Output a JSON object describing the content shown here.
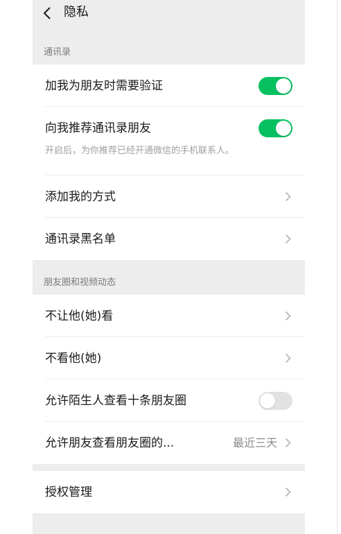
{
  "header": {
    "title": "隐私",
    "back_icon": "chevron-left-icon"
  },
  "sections": {
    "contacts": {
      "label": "通讯录"
    },
    "moments": {
      "label": "朋友圈和视频动态"
    }
  },
  "rows": {
    "verify": {
      "label": "加我为朋友时需要验证",
      "toggle": true
    },
    "recommend": {
      "label": "向我推荐通讯录朋友",
      "desc": "开启后，为你推荐已经开通微信的手机联系人。",
      "toggle": true
    },
    "add_methods": {
      "label": "添加我的方式"
    },
    "blacklist": {
      "label": "通讯录黑名单"
    },
    "hide_from": {
      "label": "不让他(她)看"
    },
    "dont_see": {
      "label": "不看他(她)"
    },
    "strangers": {
      "label": "允许陌生人查看十条朋友圈",
      "toggle": false
    },
    "friends_range": {
      "label": "允许朋友查看朋友圈的...",
      "value": "最近三天"
    },
    "authorization": {
      "label": "授权管理"
    }
  },
  "colors": {
    "accent": "#07c160",
    "background": "#ededed",
    "toggle_off": "#e2e2e2"
  },
  "icons": {
    "row_chevron": "chevron-right-icon"
  }
}
